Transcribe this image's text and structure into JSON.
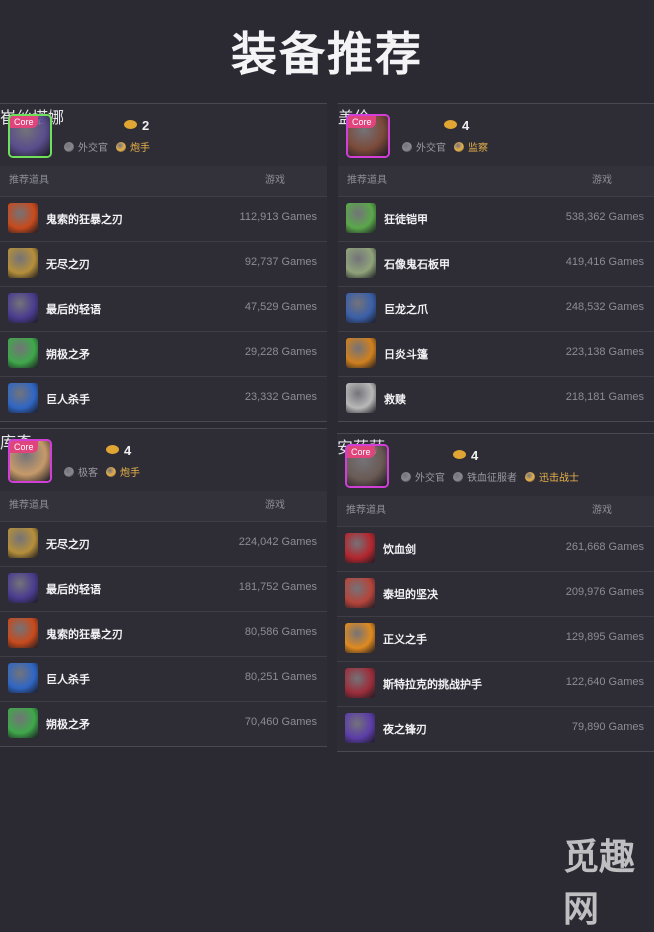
{
  "page": {
    "title": "装备推荐"
  },
  "watermark": "觅趣网",
  "header_labels": {
    "items": "推荐道具",
    "games": "游戏"
  },
  "cards": [
    {
      "champion": "崔丝塔娜",
      "badge": "Core",
      "tier": "2",
      "avatar_color": "#5a4d8c",
      "border_color": "#6fe05a",
      "roles": [
        {
          "label": "外交官",
          "gold": false,
          "icon_color": "#8a8990"
        },
        {
          "label": "炮手",
          "gold": true,
          "icon_color": "#e9b24a"
        }
      ],
      "items": [
        {
          "name": "鬼索的狂暴之刃",
          "games": "112,913 Games",
          "icon": "blade-icon",
          "color": "#c74a1c"
        },
        {
          "name": "无尽之刃",
          "games": "92,737 Games",
          "icon": "sword-icon",
          "color": "#b58f3a"
        },
        {
          "name": "最后的轻语",
          "games": "47,529 Games",
          "icon": "bow-icon",
          "color": "#4b3c8f"
        },
        {
          "name": "朔极之矛",
          "games": "29,228 Games",
          "icon": "spear-icon",
          "color": "#3fa84a"
        },
        {
          "name": "巨人杀手",
          "games": "23,332 Games",
          "icon": "hammer-icon",
          "color": "#2f66c4"
        }
      ]
    },
    {
      "champion": "盖伦",
      "badge": "Core",
      "tier": "4",
      "avatar_color": "#7b4a3a",
      "border_color": "#d13fd8",
      "roles": [
        {
          "label": "外交官",
          "gold": false,
          "icon_color": "#8a8990"
        },
        {
          "label": "监察",
          "gold": true,
          "icon_color": "#e9b24a"
        }
      ],
      "items": [
        {
          "name": "狂徒铠甲",
          "games": "538,362 Games",
          "icon": "armor-icon",
          "color": "#5aa84a"
        },
        {
          "name": "石像鬼石板甲",
          "games": "419,416 Games",
          "icon": "gargoyle-icon",
          "color": "#8fa37a"
        },
        {
          "name": "巨龙之爪",
          "games": "248,532 Games",
          "icon": "claw-icon",
          "color": "#3a5fa8"
        },
        {
          "name": "日炎斗篷",
          "games": "223,138 Games",
          "icon": "cloak-icon",
          "color": "#d0801e"
        },
        {
          "name": "救赎",
          "games": "218,181 Games",
          "icon": "redemption-icon",
          "color": "#b9b9b9"
        }
      ]
    },
    {
      "champion": "库奇",
      "badge": "Core",
      "tier": "4",
      "avatar_color": "#c69a6a",
      "border_color": "#d13fd8",
      "roles": [
        {
          "label": "极客",
          "gold": false,
          "icon_color": "#8a8990"
        },
        {
          "label": "炮手",
          "gold": true,
          "icon_color": "#e9b24a"
        }
      ],
      "items": [
        {
          "name": "无尽之刃",
          "games": "224,042 Games",
          "icon": "sword-icon",
          "color": "#b58f3a"
        },
        {
          "name": "最后的轻语",
          "games": "181,752 Games",
          "icon": "bow-icon",
          "color": "#4b3c8f"
        },
        {
          "name": "鬼索的狂暴之刃",
          "games": "80,586 Games",
          "icon": "blade-icon",
          "color": "#c74a1c"
        },
        {
          "name": "巨人杀手",
          "games": "80,251 Games",
          "icon": "hammer-icon",
          "color": "#2f66c4"
        },
        {
          "name": "朔极之矛",
          "games": "70,460 Games",
          "icon": "spear-icon",
          "color": "#3fa84a"
        }
      ]
    },
    {
      "champion": "安蓓萨",
      "badge": "Core",
      "tier": "4",
      "avatar_color": "#6a5a54",
      "border_color": "#d13fd8",
      "roles": [
        {
          "label": "外交官",
          "gold": false,
          "icon_color": "#8a8990"
        },
        {
          "label": "铁血征服者",
          "gold": false,
          "icon_color": "#8a8990"
        },
        {
          "label": "迅击战士",
          "gold": true,
          "icon_color": "#e9b24a"
        }
      ],
      "items": [
        {
          "name": "饮血剑",
          "games": "261,668 Games",
          "icon": "bloodthirster-icon",
          "color": "#b3262e"
        },
        {
          "name": "泰坦的坚决",
          "games": "209,976 Games",
          "icon": "titan-icon",
          "color": "#b5443a"
        },
        {
          "name": "正义之手",
          "games": "129,895 Games",
          "icon": "hand-icon",
          "color": "#e08a1e"
        },
        {
          "name": "斯特拉克的挑战护手",
          "games": "122,640 Games",
          "icon": "gauntlet-icon",
          "color": "#9b2d3a"
        },
        {
          "name": "夜之锋刃",
          "games": "79,890 Games",
          "icon": "edge-icon",
          "color": "#5c3da8"
        }
      ]
    }
  ]
}
